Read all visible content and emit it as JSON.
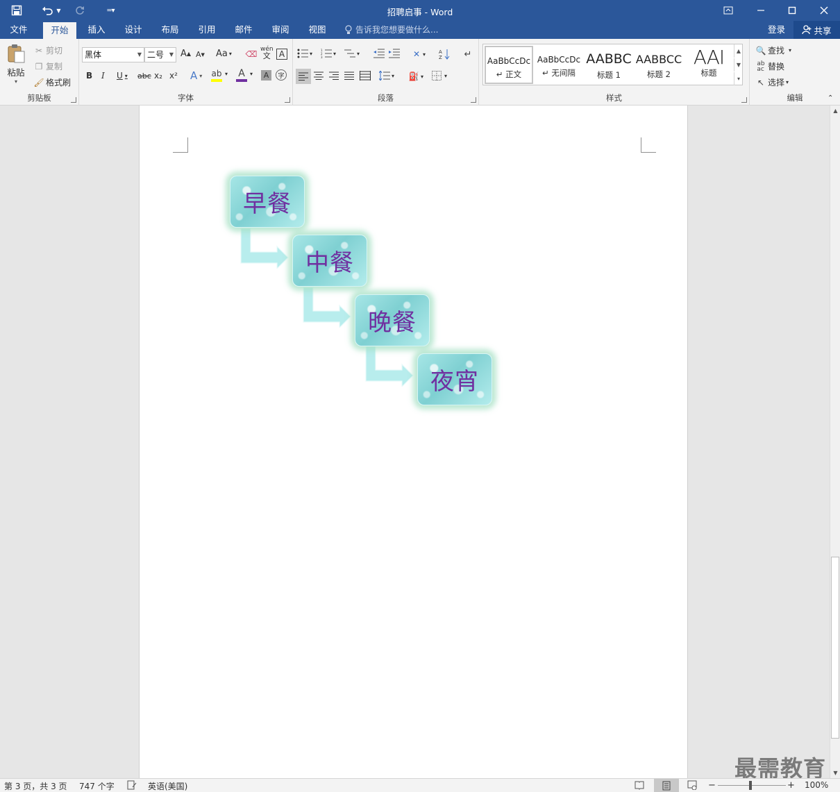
{
  "window": {
    "title": "招聘启事 - Word"
  },
  "tabs": [
    {
      "label": "文件"
    },
    {
      "label": "开始"
    },
    {
      "label": "插入"
    },
    {
      "label": "设计"
    },
    {
      "label": "布局"
    },
    {
      "label": "引用"
    },
    {
      "label": "邮件"
    },
    {
      "label": "审阅"
    },
    {
      "label": "视图"
    }
  ],
  "tellme": "告诉我您想要做什么...",
  "account": {
    "login": "登录",
    "share": "共享"
  },
  "clipboard": {
    "paste": "粘贴",
    "cut": "剪切",
    "copy": "复制",
    "format_painter": "格式刷",
    "label": "剪贴板"
  },
  "font": {
    "name": "黑体",
    "size": "二号",
    "label": "字体",
    "grow": "A",
    "shrink": "A",
    "case": "Aa",
    "bold": "B",
    "italic": "I",
    "underline": "U",
    "strike": "abc",
    "subscript": "x₂",
    "superscript": "x²",
    "phonetic_top": "wén",
    "phonetic_bottom": "文",
    "border_char": "A",
    "highlight_color": "#ffff00",
    "font_color": "#7030a0"
  },
  "paragraph": {
    "label": "段落"
  },
  "styles": {
    "label": "样式",
    "items": [
      {
        "preview": "AaBbCcDc",
        "name": "↵ 正文"
      },
      {
        "preview": "AaBbCcDc",
        "name": "↵ 无间隔"
      },
      {
        "preview": "AABBC",
        "name": "标题 1"
      },
      {
        "preview": "AABBCC",
        "name": "标题 2"
      },
      {
        "preview": "AAI",
        "name": "标题"
      }
    ]
  },
  "editing": {
    "find": "查找",
    "replace": "替换",
    "select": "选择",
    "label": "编辑"
  },
  "document": {
    "meals": [
      "早餐",
      "中餐",
      "晚餐",
      "夜宵"
    ]
  },
  "status": {
    "page": "第 3 页，共 3 页",
    "words": "747 个字",
    "language": "英语(美国)",
    "zoom": "100%"
  },
  "watermark": "最需教育"
}
